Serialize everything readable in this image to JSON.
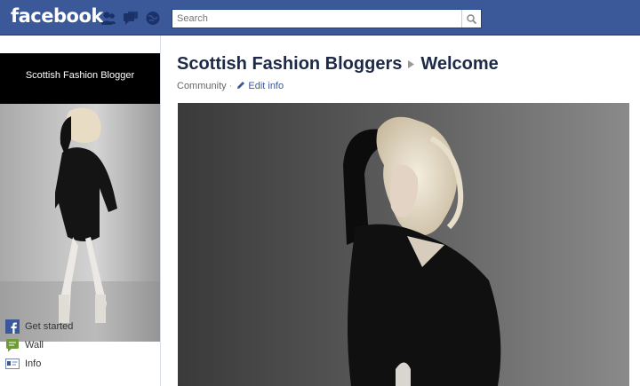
{
  "header": {
    "logo": "facebook",
    "search_placeholder": "Search",
    "icons": [
      "friend-requests-icon",
      "messages-icon",
      "notifications-icon",
      "search-icon"
    ]
  },
  "sidebar": {
    "banner_text": "Scottish Fashion Blogger",
    "items": [
      {
        "label": "Get started",
        "icon": "facebook-f-icon"
      },
      {
        "label": "Wall",
        "icon": "wall-icon"
      },
      {
        "label": "Info",
        "icon": "info-icon"
      }
    ]
  },
  "page": {
    "title": "Scottish Fashion Bloggers",
    "section": "Welcome",
    "category": "Community",
    "edit_label": "Edit info"
  },
  "colors": {
    "brand_blue": "#3b5998",
    "title_color": "#1c2a47"
  }
}
